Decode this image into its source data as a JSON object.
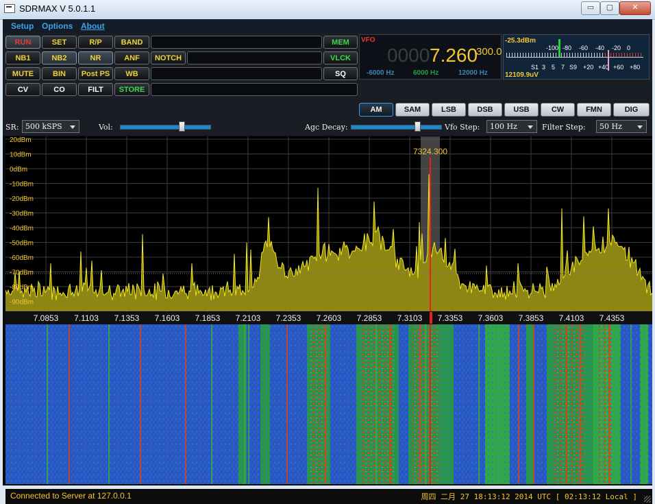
{
  "window": {
    "title": "SDRMAX V 5.0.1.1",
    "min_glyph": "▭",
    "max_glyph": "▢",
    "close_glyph": "✕"
  },
  "menu": [
    "Setup",
    "Options",
    "About"
  ],
  "buttons": {
    "row1": [
      "RUN",
      "SET",
      "R/P",
      "BAND",
      "MEM"
    ],
    "row2": [
      "NB1",
      "NB2",
      "NR",
      "ANF",
      "NOTCH",
      "VLCK"
    ],
    "row3": [
      "MUTE",
      "BIN",
      "Post PS",
      "WB",
      "SQ"
    ],
    "row4": [
      "CV",
      "CO",
      "FILT",
      "STORE"
    ]
  },
  "vfo": {
    "label": "VFO",
    "lead": "0000",
    "main": "7.260",
    "sub": "300.0",
    "offsets": [
      "-6000 Hz",
      "6000 Hz",
      "12000 Hz"
    ]
  },
  "meter": {
    "dbm": "-25.3dBm",
    "uv": "12109.9uV",
    "top_scale": [
      "-100",
      "-80",
      "-60",
      "-40",
      "-20",
      "0"
    ],
    "bottom_scale": [
      "S1",
      "3",
      "5",
      "7",
      "S9",
      "+20",
      "+40",
      "+60",
      "+80"
    ],
    "level_dbm": -25.3
  },
  "modes": [
    "AM",
    "SAM",
    "LSB",
    "DSB",
    "USB",
    "CW",
    "FMN",
    "DIG"
  ],
  "selected_mode": "AM",
  "controls": {
    "sr_label": "SR:",
    "sr_value": "500 kSPS",
    "vol_label": "Vol:",
    "vol_level": 0.7,
    "agc_label": "Agc Decay:",
    "agc_level": 0.75,
    "vfo_step_label": "Vfo Step:",
    "vfo_step_value": "100 Hz",
    "filter_step_label": "Filter Step:",
    "filter_step_value": "50 Hz"
  },
  "spectrum": {
    "db_labels": [
      "20dBm",
      "10dBm",
      "0dBm",
      "-10dBm",
      "-20dBm",
      "-30dBm",
      "-40dBm",
      "-50dBm",
      "-60dBm",
      "-70dBm",
      "-80dBm",
      "-90dBm"
    ],
    "freq_labels": [
      "7.0853",
      "7.1103",
      "7.1353",
      "7.1603",
      "7.1853",
      "7.2103",
      "7.2353",
      "7.2603",
      "7.2853",
      "7.3103",
      "7.3353",
      "7.3603",
      "7.3853",
      "7.4103",
      "7.4353"
    ],
    "marker": "7324.300",
    "trace_color": "#f2e81c",
    "fill_color": "#8d8514",
    "marker_color": "#e8201a"
  },
  "status": {
    "left": "Connected to Server at 127.0.0.1",
    "right": "周四 二月 27 18:13:12 2014 UTC [ 02:13:12 Local ]"
  }
}
